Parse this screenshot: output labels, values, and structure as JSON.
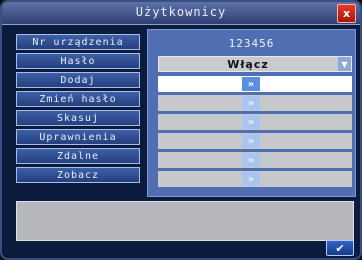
{
  "window": {
    "title": "Użytkownicy",
    "close_glyph": "x",
    "ok_glyph": "✔"
  },
  "menu": {
    "items": [
      {
        "label": "Nr urządzenia"
      },
      {
        "label": "Hasło"
      },
      {
        "label": "Dodaj"
      },
      {
        "label": "Zmień hasło"
      },
      {
        "label": "Skasuj"
      },
      {
        "label": "Uprawnienia"
      },
      {
        "label": "Zdalne"
      },
      {
        "label": "Zobacz"
      }
    ]
  },
  "panel": {
    "device_number": "123456",
    "password_select": {
      "value": "Włącz",
      "dropdown_glyph": "▼"
    },
    "arrow_glyph": "»",
    "rows": [
      {
        "id": "dodaj",
        "active": true
      },
      {
        "id": "zmien-haslo",
        "active": false
      },
      {
        "id": "skasuj",
        "active": false
      },
      {
        "id": "uprawnienia",
        "active": false
      },
      {
        "id": "zdalne",
        "active": false
      },
      {
        "id": "zobacz",
        "active": false
      }
    ]
  },
  "status_box": {
    "text": ""
  },
  "colors": {
    "window_bg": "#0b1b3d",
    "panel_bg": "#4f6fb2",
    "button_bg": "#3f5fa6",
    "close_red": "#e23a2a",
    "arrow_active": "#5a8fe0"
  },
  "icons": {
    "close": "close-icon",
    "ok": "checkmark-icon",
    "dropdown": "chevron-down-icon",
    "arrow": "double-chevron-right-icon"
  }
}
